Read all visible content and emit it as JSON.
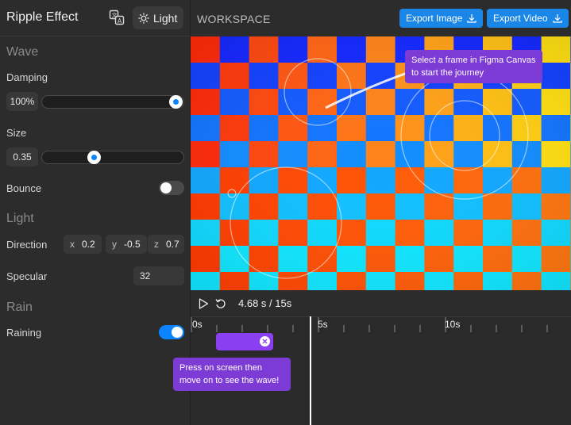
{
  "app": {
    "title": "Ripple Effect",
    "theme_label": "Light"
  },
  "sections": {
    "wave": "Wave",
    "light": "Light",
    "rain": "Rain"
  },
  "controls": {
    "damping": {
      "label": "Damping",
      "value": "100%",
      "fraction": 1.0
    },
    "size": {
      "label": "Size",
      "value": "0.35",
      "fraction": 0.35
    },
    "bounce": {
      "label": "Bounce",
      "on": false
    },
    "direction": {
      "label": "Direction",
      "x_label": "x",
      "x": "0.2",
      "y_label": "y",
      "y": "-0.5",
      "z_label": "z",
      "z": "0.7"
    },
    "specular": {
      "label": "Specular",
      "value": "32"
    },
    "raining": {
      "label": "Raining",
      "on": true
    }
  },
  "workspace": {
    "title": "WORKSPACE",
    "export_image": "Export Image",
    "export_video": "Export Video",
    "canvas_tooltip_line1": "Select a frame in Figma Canvas",
    "canvas_tooltip_line2": "to start the journey"
  },
  "timeline": {
    "readout": "4.68 s / 15s",
    "ticks": [
      "0s",
      "5s",
      "10s"
    ],
    "tooltip_line1": "Press on screen then",
    "tooltip_line2": "move on to see the wave!"
  },
  "colors": {
    "accent": "#0d84ff",
    "export": "#1a86e8",
    "tooltip": "#7d3bd6",
    "clip": "#8a3ff0"
  }
}
